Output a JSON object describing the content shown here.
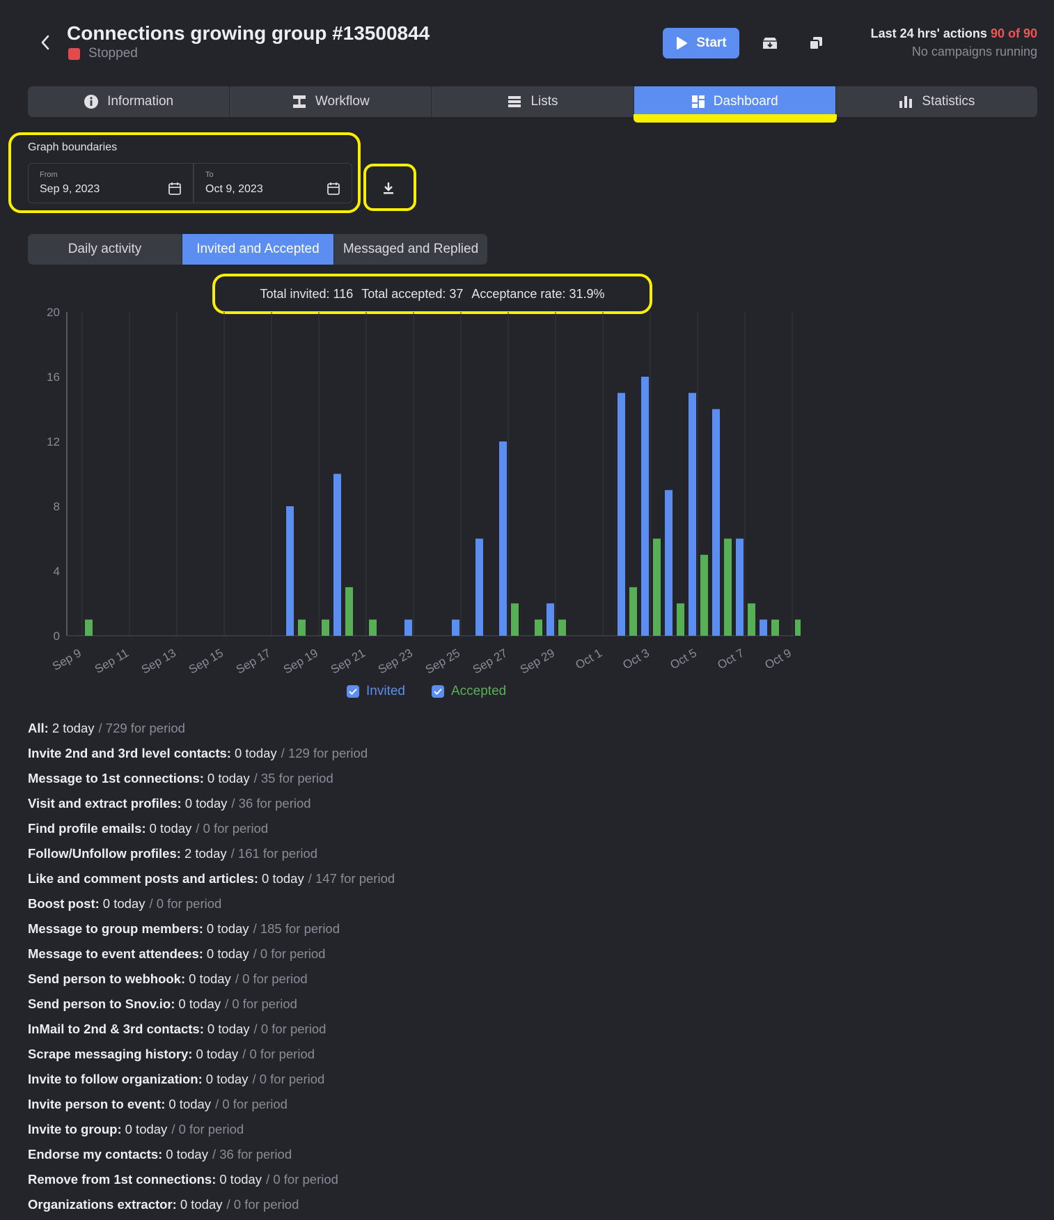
{
  "header": {
    "title": "Connections growing group #13500844",
    "status": "Stopped",
    "start_label": "Start",
    "actions_label": "Last 24 hrs' actions",
    "actions_count": "90 of 90",
    "actions_sub": "No campaigns running"
  },
  "tabs": [
    {
      "label": "Information",
      "icon": "info-icon"
    },
    {
      "label": "Workflow",
      "icon": "workflow-icon"
    },
    {
      "label": "Lists",
      "icon": "list-icon"
    },
    {
      "label": "Dashboard",
      "icon": "dashboard-icon"
    },
    {
      "label": "Statistics",
      "icon": "bar-chart-icon"
    }
  ],
  "active_tab": "Dashboard",
  "graph_boundaries": {
    "label": "Graph boundaries",
    "from_label": "From",
    "from_value": "Sep 9, 2023",
    "to_label": "To",
    "to_value": "Oct 9, 2023"
  },
  "subtabs": [
    {
      "label": "Daily activity"
    },
    {
      "label": "Invited and Accepted"
    },
    {
      "label": "Messaged and Replied"
    }
  ],
  "active_subtab": "Invited and Accepted",
  "summary": {
    "invited": "Total invited: 116",
    "accepted": "Total accepted: 37",
    "rate": "Acceptance rate: 31.9%"
  },
  "chart_data": {
    "type": "bar",
    "categories": [
      "Sep 9",
      "Sep 10",
      "Sep 11",
      "Sep 12",
      "Sep 13",
      "Sep 14",
      "Sep 15",
      "Sep 16",
      "Sep 17",
      "Sep 18",
      "Sep 19",
      "Sep 20",
      "Sep 21",
      "Sep 22",
      "Sep 23",
      "Sep 24",
      "Sep 25",
      "Sep 26",
      "Sep 27",
      "Sep 28",
      "Sep 29",
      "Sep 30",
      "Oct 1",
      "Oct 2",
      "Oct 3",
      "Oct 4",
      "Oct 5",
      "Oct 6",
      "Oct 7",
      "Oct 8",
      "Oct 9"
    ],
    "tick_labels": [
      "Sep 9",
      "Sep 11",
      "Sep 13",
      "Sep 15",
      "Sep 17",
      "Sep 19",
      "Sep 21",
      "Sep 23",
      "Sep 25",
      "Sep 27",
      "Sep 29",
      "Oct 1",
      "Oct 3",
      "Oct 5",
      "Oct 7",
      "Oct 9"
    ],
    "series": [
      {
        "name": "Invited",
        "color": "#5b8ef0",
        "values": [
          0,
          0,
          0,
          0,
          0,
          0,
          0,
          0,
          0,
          8,
          0,
          10,
          0,
          0,
          1,
          0,
          1,
          6,
          12,
          0,
          2,
          0,
          0,
          15,
          16,
          9,
          15,
          14,
          6,
          1,
          0
        ]
      },
      {
        "name": "Accepted",
        "color": "#58b056",
        "values": [
          1,
          0,
          0,
          0,
          0,
          0,
          0,
          0,
          0,
          1,
          1,
          3,
          1,
          0,
          0,
          0,
          0,
          0,
          2,
          1,
          1,
          0,
          0,
          3,
          6,
          2,
          5,
          6,
          2,
          1,
          1
        ]
      }
    ],
    "yticks": [
      0,
      4,
      8,
      12,
      16,
      20
    ],
    "ylim": [
      0,
      20
    ],
    "grid": "vertical",
    "legend": "bottom-center"
  },
  "stats": [
    {
      "name": "All:",
      "today": "2 today",
      "period": "/ 729 for period"
    },
    {
      "name": "Invite 2nd and 3rd level contacts:",
      "today": "0 today",
      "period": "/ 129 for period"
    },
    {
      "name": "Message to 1st connections:",
      "today": "0 today",
      "period": "/ 35 for period"
    },
    {
      "name": "Visit and extract profiles:",
      "today": "0 today",
      "period": "/ 36 for period"
    },
    {
      "name": "Find profile emails:",
      "today": "0 today",
      "period": "/ 0 for period"
    },
    {
      "name": "Follow/Unfollow profiles:",
      "today": "2 today",
      "period": "/ 161 for period"
    },
    {
      "name": "Like and comment posts and articles:",
      "today": "0 today",
      "period": "/ 147 for period"
    },
    {
      "name": "Boost post:",
      "today": "0 today",
      "period": "/ 0 for period"
    },
    {
      "name": "Message to group members:",
      "today": "0 today",
      "period": "/ 185 for period"
    },
    {
      "name": "Message to event attendees:",
      "today": "0 today",
      "period": "/ 0 for period"
    },
    {
      "name": "Send person to webhook:",
      "today": "0 today",
      "period": "/ 0 for period"
    },
    {
      "name": "Send person to Snov.io:",
      "today": "0 today",
      "period": "/ 0 for period"
    },
    {
      "name": "InMail to 2nd & 3rd contacts:",
      "today": "0 today",
      "period": "/ 0 for period"
    },
    {
      "name": "Scrape messaging history:",
      "today": "0 today",
      "period": "/ 0 for period"
    },
    {
      "name": "Invite to follow organization:",
      "today": "0 today",
      "period": "/ 0 for period"
    },
    {
      "name": "Invite person to event:",
      "today": "0 today",
      "period": "/ 0 for period"
    },
    {
      "name": "Invite to group:",
      "today": "0 today",
      "period": "/ 0 for period"
    },
    {
      "name": "Endorse my contacts:",
      "today": "0 today",
      "period": "/ 36 for period"
    },
    {
      "name": "Remove from 1st connections:",
      "today": "0 today",
      "period": "/ 0 for period"
    },
    {
      "name": "Organizations extractor:",
      "today": "0 today",
      "period": "/ 0 for period"
    }
  ],
  "colors": {
    "background": "#24252b",
    "accent": "#5b8ef0",
    "accepted": "#58b056",
    "highlight": "#f8f000",
    "stopped": "#e14b4b"
  }
}
